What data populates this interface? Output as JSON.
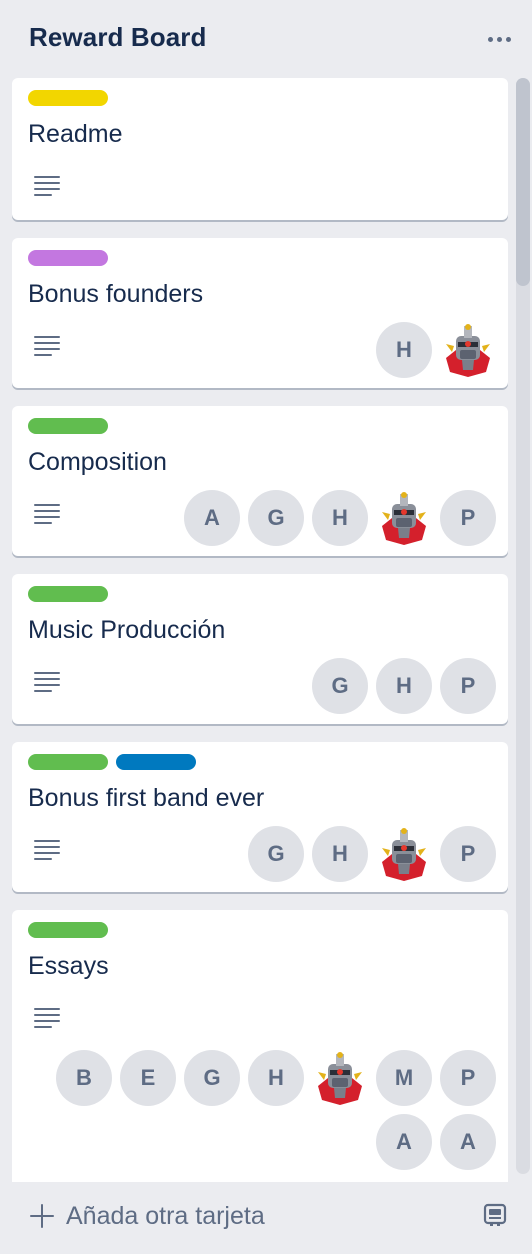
{
  "list": {
    "title": "Reward Board",
    "menu_icon": "more-horizontal-icon"
  },
  "colors": {
    "yellow": "#f2d600",
    "purple": "#c377e0",
    "green": "#61bd4f",
    "blue": "#0079bf",
    "avatar_bg": "#dfe1e6",
    "avatar_text": "#5e6c84"
  },
  "cards": [
    {
      "title": "Readme",
      "labels": [
        "yellow"
      ],
      "has_description": true,
      "members": []
    },
    {
      "title": "Bonus founders",
      "labels": [
        "purple"
      ],
      "has_description": true,
      "members": [
        "H",
        "robot-avatar"
      ]
    },
    {
      "title": "Composition",
      "labels": [
        "green"
      ],
      "has_description": true,
      "members": [
        "A",
        "G",
        "H",
        "robot-avatar",
        "P"
      ]
    },
    {
      "title": "Music Producción",
      "labels": [
        "green"
      ],
      "has_description": true,
      "members": [
        "G",
        "H",
        "P"
      ]
    },
    {
      "title": "Bonus first band ever",
      "labels": [
        "green",
        "blue"
      ],
      "has_description": true,
      "members": [
        "G",
        "H",
        "robot-avatar",
        "P"
      ]
    },
    {
      "title": "Essays",
      "labels": [
        "green"
      ],
      "has_description": true,
      "members": [
        "B",
        "E",
        "G",
        "H",
        "robot-avatar",
        "M",
        "P",
        "A",
        "A"
      ]
    }
  ],
  "composer": {
    "add_label": "Añada otra tarjeta",
    "add_icon": "plus-icon",
    "template_icon": "card-template-icon"
  }
}
